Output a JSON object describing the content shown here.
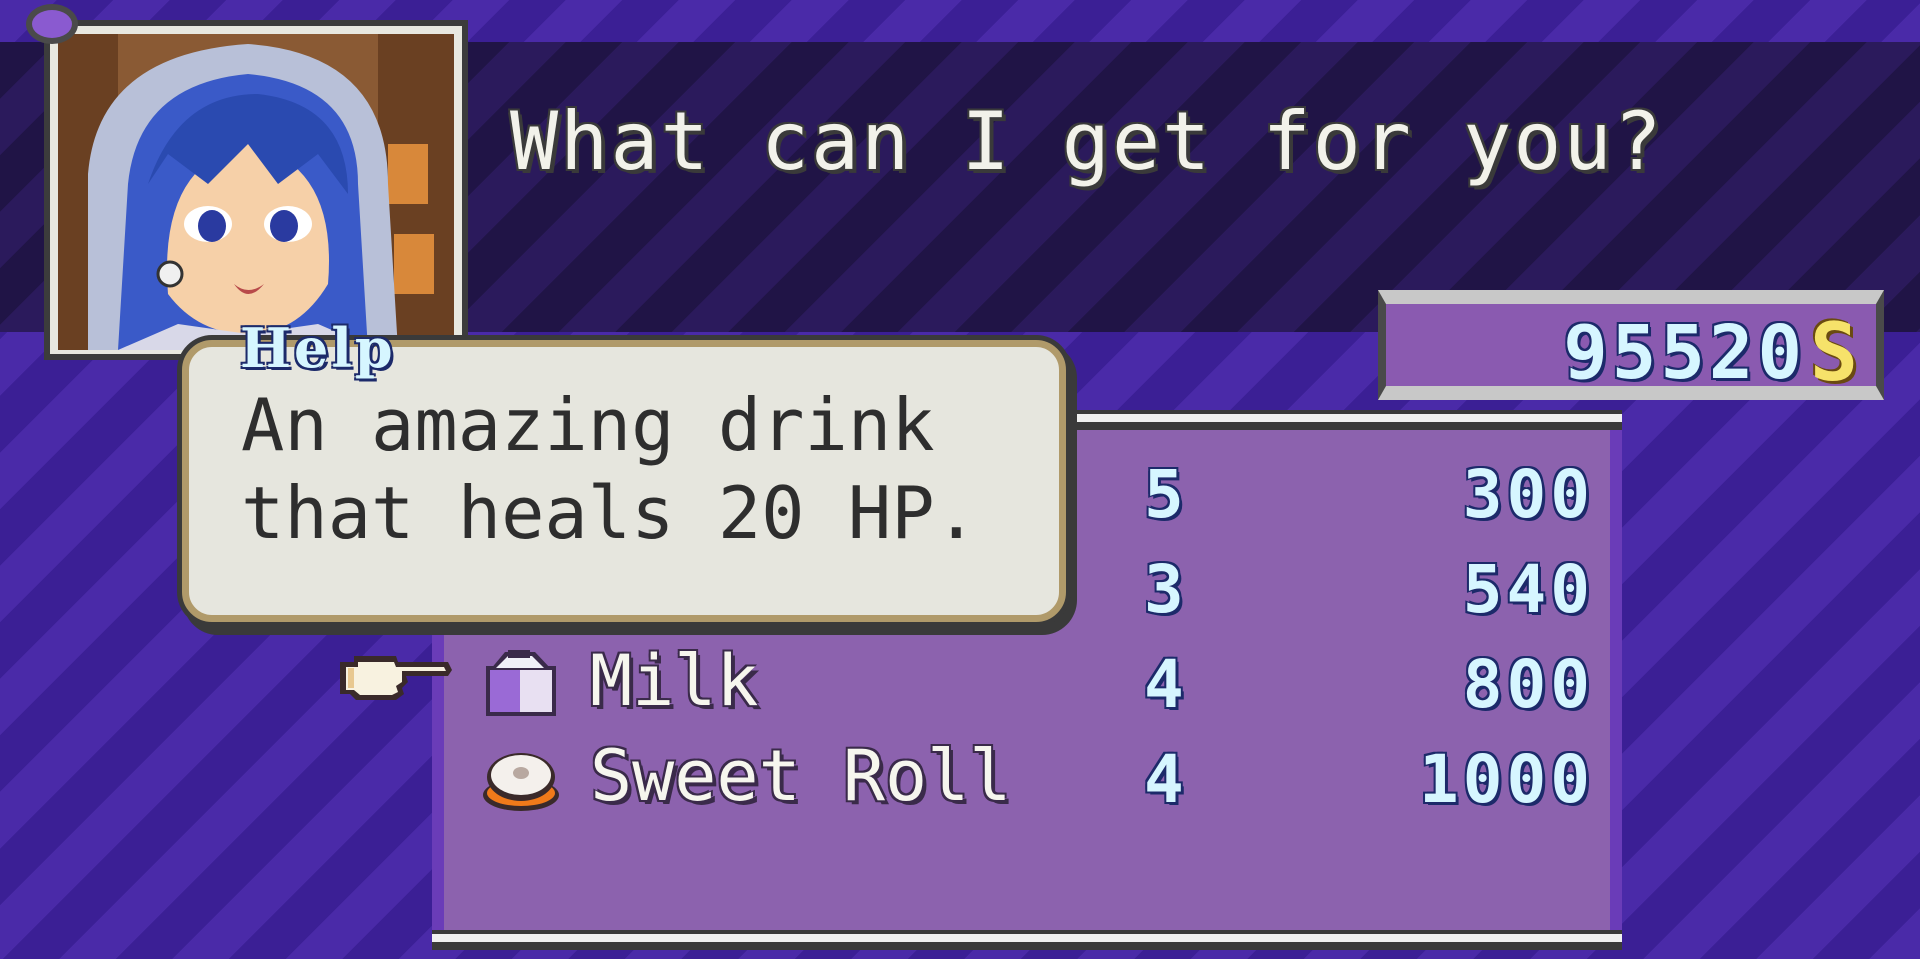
{
  "dialogue": {
    "text": "What can I get for you?"
  },
  "money": {
    "amount": "95520",
    "symbol": "S"
  },
  "help": {
    "tag": "Help",
    "line1": "An amazing drink",
    "line2": "that heals 20 HP."
  },
  "shop": {
    "items": [
      {
        "name": "",
        "stock": "5",
        "price": "300",
        "icon": "hidden-item-icon"
      },
      {
        "name": "",
        "stock": "3",
        "price": "540",
        "icon": "hidden-item-icon"
      },
      {
        "name": "Milk",
        "stock": "4",
        "price": "800",
        "icon": "milk-carton-icon"
      },
      {
        "name": "Sweet Roll",
        "stock": "4",
        "price": "1000",
        "icon": "sweet-roll-icon"
      }
    ],
    "selected_index": 2
  },
  "colors": {
    "background": "#4a2aa8",
    "dialogue_band": "#201446",
    "panel": "#8c62ae",
    "number_text": "#d6f6ff",
    "gold": "#f6e26a"
  }
}
